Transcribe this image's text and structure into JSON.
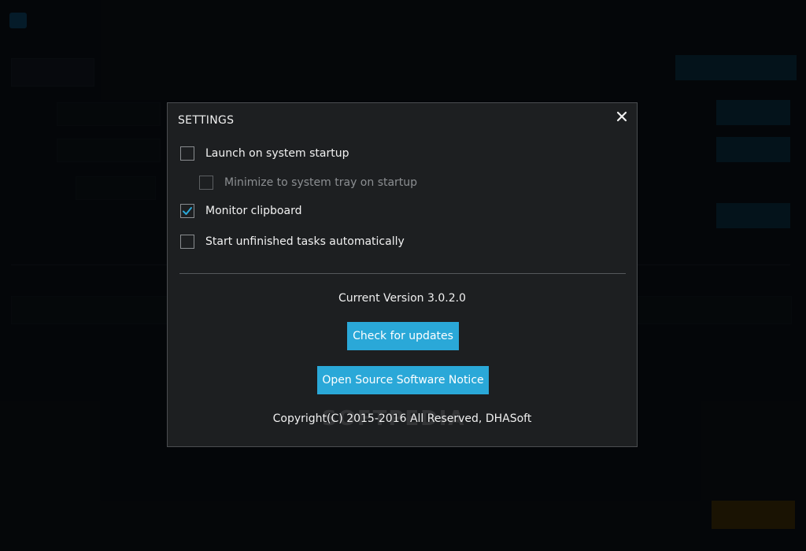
{
  "dialog": {
    "title": "SETTINGS",
    "options": [
      {
        "label": "Launch on system startup",
        "checked": false
      },
      {
        "label": "Minimize to system tray on startup",
        "checked": false,
        "disabled": true
      },
      {
        "label": "Monitor clipboard",
        "checked": true
      },
      {
        "label": "Start unfinished tasks automatically",
        "checked": false
      }
    ],
    "version_text": "Current Version 3.0.2.0",
    "check_updates_label": "Check for updates",
    "open_source_label": "Open Source Software Notice",
    "copyright": "Copyright(C) 2015-2016 All Reserved, DHASoft"
  },
  "watermark": "SOFTPEDIA",
  "colors": {
    "accent": "#2aa8d8",
    "dialog_bg": "#1d1f21",
    "checkmark": "#2aa8d8"
  }
}
